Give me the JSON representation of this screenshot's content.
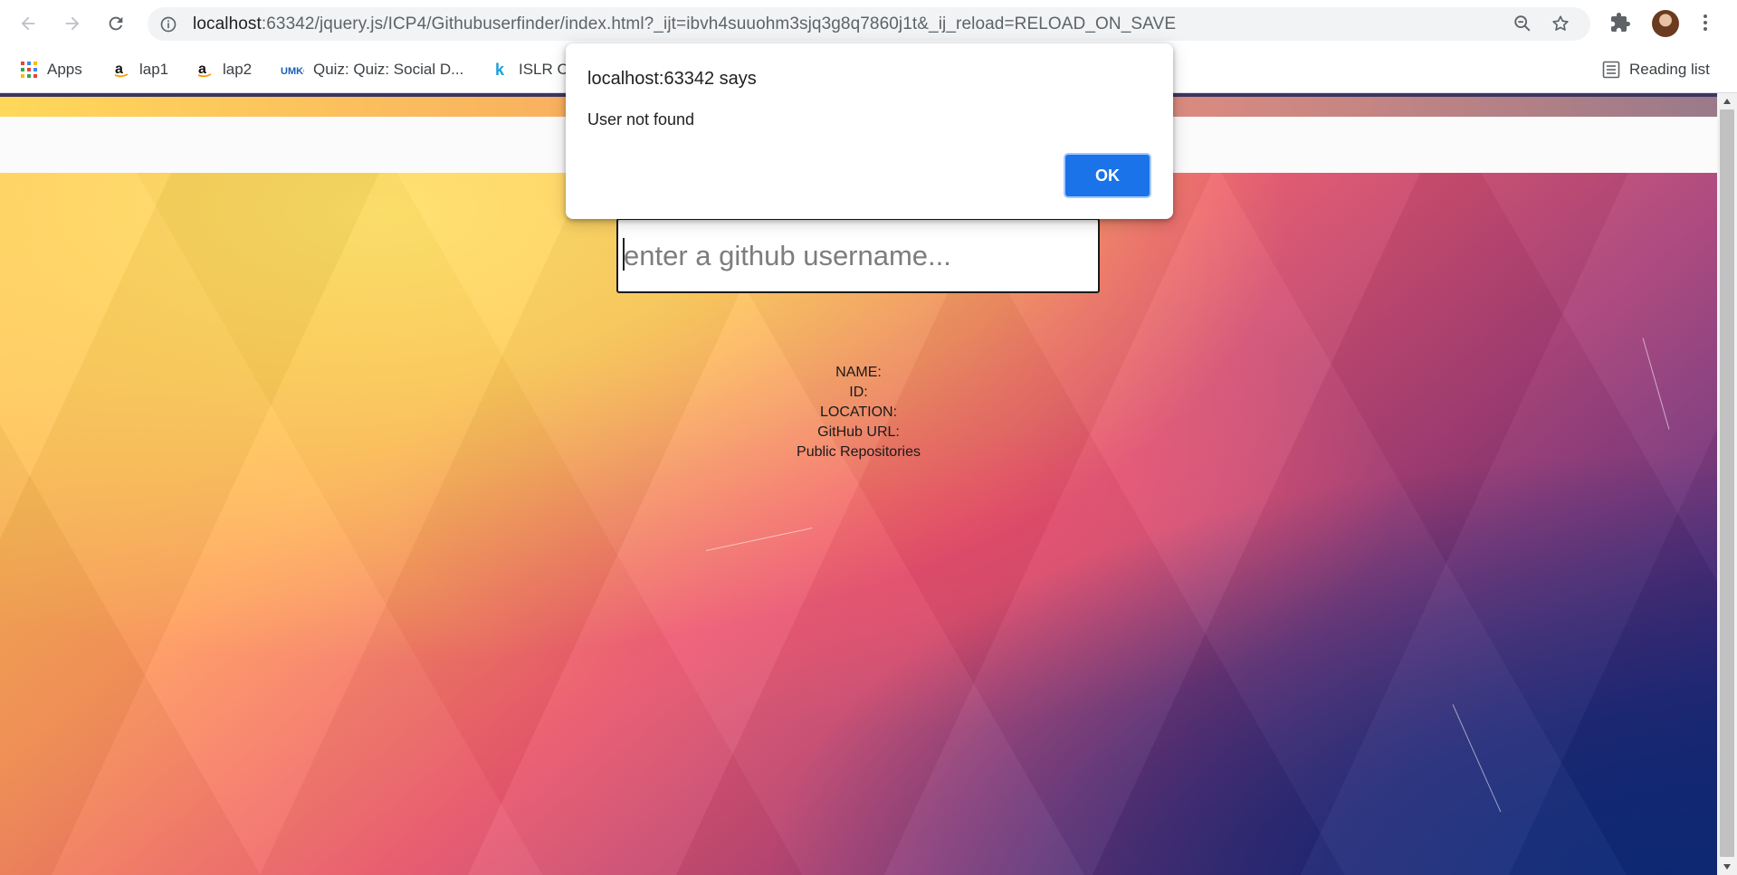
{
  "browser": {
    "url_host": "localhost",
    "url_rest": ":63342/jquery.js/ICP4/Githubuserfinder/index.html?_ijt=ibvh4suuohm3sjq3g8q7860j1t&_ij_reload=RELOAD_ON_SAVE",
    "bookmarks": [
      {
        "label": "Apps",
        "icon": "apps-grid-icon"
      },
      {
        "label": "lap1",
        "icon": "amazon-icon"
      },
      {
        "label": "lap2",
        "icon": "amazon-icon"
      },
      {
        "label": "Quiz: Quiz: Social D...",
        "icon": "umkc-icon"
      },
      {
        "label": "ISLR C",
        "icon": "k-icon"
      }
    ],
    "reading_list": "Reading list"
  },
  "page": {
    "search_placeholder": "enter a github username...",
    "info": {
      "name": "NAME:",
      "id": "ID:",
      "location": "LOCATION:",
      "github_url": "GitHub URL:",
      "repos": "Public Repositories"
    }
  },
  "dialog": {
    "title": "localhost:63342 says",
    "message": "User not found",
    "ok_label": "OK"
  },
  "colors": {
    "accent": "#1a73e8",
    "background_gradient": [
      "#ffd24d",
      "#ee5a6f",
      "#1c2d8a"
    ]
  }
}
